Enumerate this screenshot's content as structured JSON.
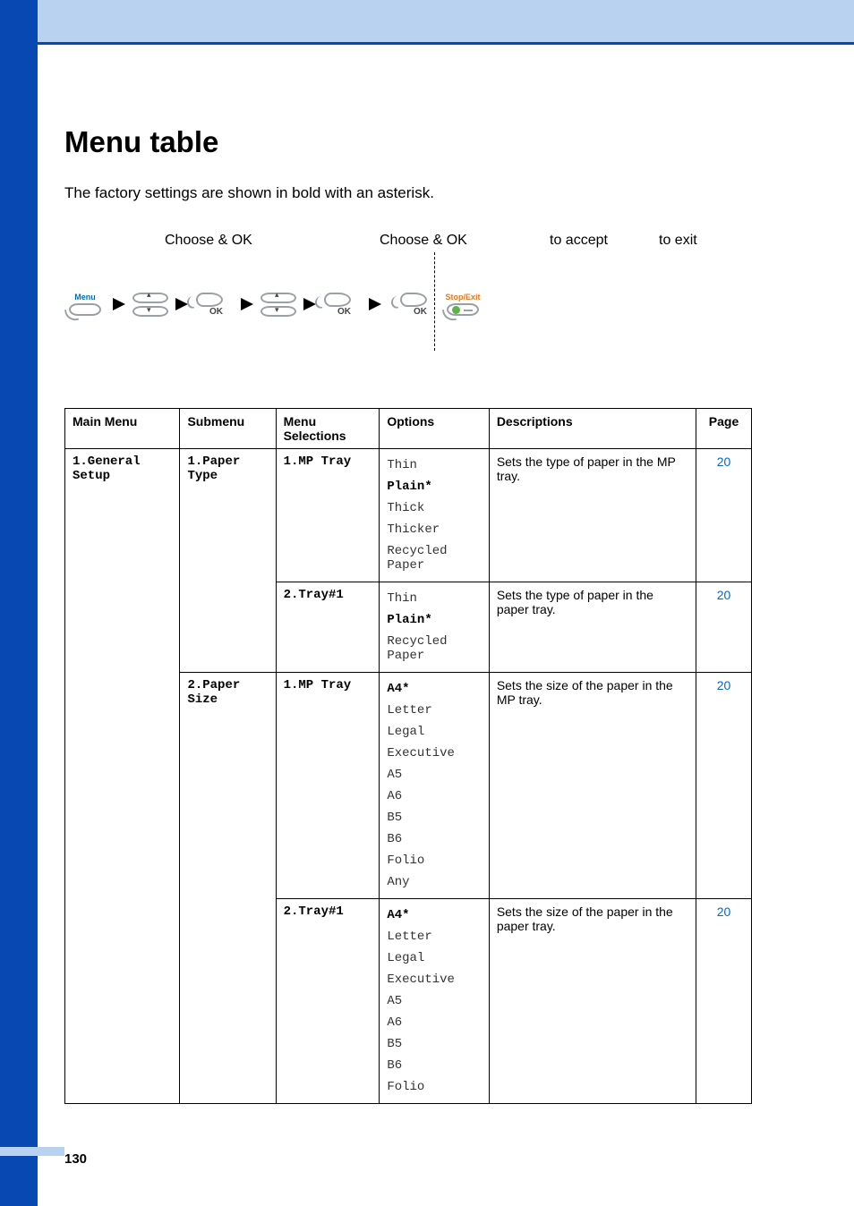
{
  "heading": "Menu table",
  "intro": "The factory settings are shown in bold with an asterisk.",
  "flow": {
    "label1": "Choose & OK",
    "label2": "Choose & OK",
    "label3": "to accept",
    "label4": "to exit",
    "menu_btn": "Menu",
    "ok": "OK",
    "stop_btn": "Stop/Exit"
  },
  "table": {
    "headers": {
      "main_menu": "Main Menu",
      "submenu": "Submenu",
      "selections": "Menu Selections",
      "options": "Options",
      "descriptions": "Descriptions",
      "page": "Page"
    },
    "main_menu": "1.General Setup",
    "rows": [
      {
        "submenu": "1.Paper Type",
        "selection": "1.MP Tray",
        "options": [
          {
            "v": "Thin",
            "b": false
          },
          {
            "v": "Plain*",
            "b": true
          },
          {
            "v": "Thick",
            "b": false
          },
          {
            "v": "Thicker",
            "b": false
          },
          {
            "v": "Recycled Paper",
            "b": false
          }
        ],
        "desc": "Sets the type of paper in the MP tray.",
        "page": "20"
      },
      {
        "selection": "2.Tray#1",
        "options": [
          {
            "v": "Thin",
            "b": false
          },
          {
            "v": "Plain*",
            "b": true
          },
          {
            "v": "Recycled Paper",
            "b": false
          }
        ],
        "desc": "Sets the type of paper in the paper tray.",
        "page": "20"
      },
      {
        "submenu": "2.Paper Size",
        "selection": "1.MP Tray",
        "options": [
          {
            "v": "A4*",
            "b": true
          },
          {
            "v": "Letter",
            "b": false
          },
          {
            "v": "Legal",
            "b": false
          },
          {
            "v": "Executive",
            "b": false
          },
          {
            "v": "A5",
            "b": false
          },
          {
            "v": "A6",
            "b": false
          },
          {
            "v": "B5",
            "b": false
          },
          {
            "v": "B6",
            "b": false
          },
          {
            "v": "Folio",
            "b": false
          },
          {
            "v": "Any",
            "b": false
          }
        ],
        "desc": "Sets the size of the paper in the MP tray.",
        "page": "20"
      },
      {
        "selection": "2.Tray#1",
        "options": [
          {
            "v": "A4*",
            "b": true
          },
          {
            "v": "Letter",
            "b": false
          },
          {
            "v": "Legal",
            "b": false
          },
          {
            "v": "Executive",
            "b": false
          },
          {
            "v": "A5",
            "b": false
          },
          {
            "v": "A6",
            "b": false
          },
          {
            "v": "B5",
            "b": false
          },
          {
            "v": "B6",
            "b": false
          },
          {
            "v": "Folio",
            "b": false
          }
        ],
        "desc": "Sets the size of the paper in the paper tray.",
        "page": "20"
      }
    ]
  },
  "page_number": "130"
}
